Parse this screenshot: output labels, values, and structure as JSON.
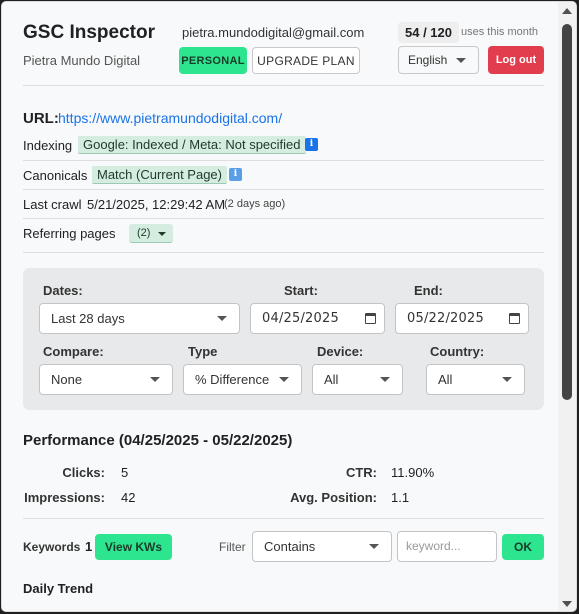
{
  "header": {
    "title": "GSC Inspector",
    "subtitle": "Pietra Mundo Digital",
    "email": "pietra.mundodigital@gmail.com",
    "usage": "54 / 120",
    "usage_label": "uses this month",
    "plan_badge": "PERSONAL",
    "upgrade_label": "UPGRADE PLAN",
    "language": "English",
    "logout_label": "Log out"
  },
  "inspection": {
    "url_label": "URL:",
    "url": "https://www.pietramundodigital.com/",
    "indexing_label": "Indexing",
    "indexing_value": "Google: Indexed / Meta: Not specified",
    "canonicals_label": "Canonicals",
    "canonicals_value": "Match (Current Page)",
    "last_crawl_label": "Last crawl",
    "last_crawl_value": "5/21/2025, 12:29:42 AM",
    "last_crawl_ago": "(2 days ago)",
    "referring_label": "Referring pages",
    "referring_value": "(2)",
    "info_glyph": "i"
  },
  "filters": {
    "dates_label": "Dates:",
    "dates_value": "Last 28 days",
    "start_label": "Start:",
    "start_value": "04/25/2025",
    "end_label": "End:",
    "end_value": "05/22/2025",
    "compare_label": "Compare:",
    "compare_value": "None",
    "type_label": "Type",
    "type_value": "% Difference",
    "device_label": "Device:",
    "device_value": "All",
    "country_label": "Country:",
    "country_value": "All"
  },
  "performance": {
    "title": "Performance (04/25/2025 - 05/22/2025)",
    "clicks_label": "Clicks:",
    "clicks_value": "5",
    "impressions_label": "Impressions:",
    "impressions_value": "42",
    "ctr_label": "CTR:",
    "ctr_value": "11.90%",
    "avg_position_label": "Avg. Position:",
    "avg_position_value": "1.1"
  },
  "keywords": {
    "label": "Keywords",
    "count": "1",
    "view_button": "View KWs",
    "filter_label": "Filter",
    "filter_value": "Contains",
    "input_placeholder": "keyword...",
    "ok_button": "OK"
  },
  "trend": {
    "title": "Daily Trend"
  },
  "colors": {
    "accent_green": "#2ee58f",
    "logout_red": "#e23d4c",
    "link_blue": "#1a73e8",
    "tag_bg": "#d5ece0"
  }
}
